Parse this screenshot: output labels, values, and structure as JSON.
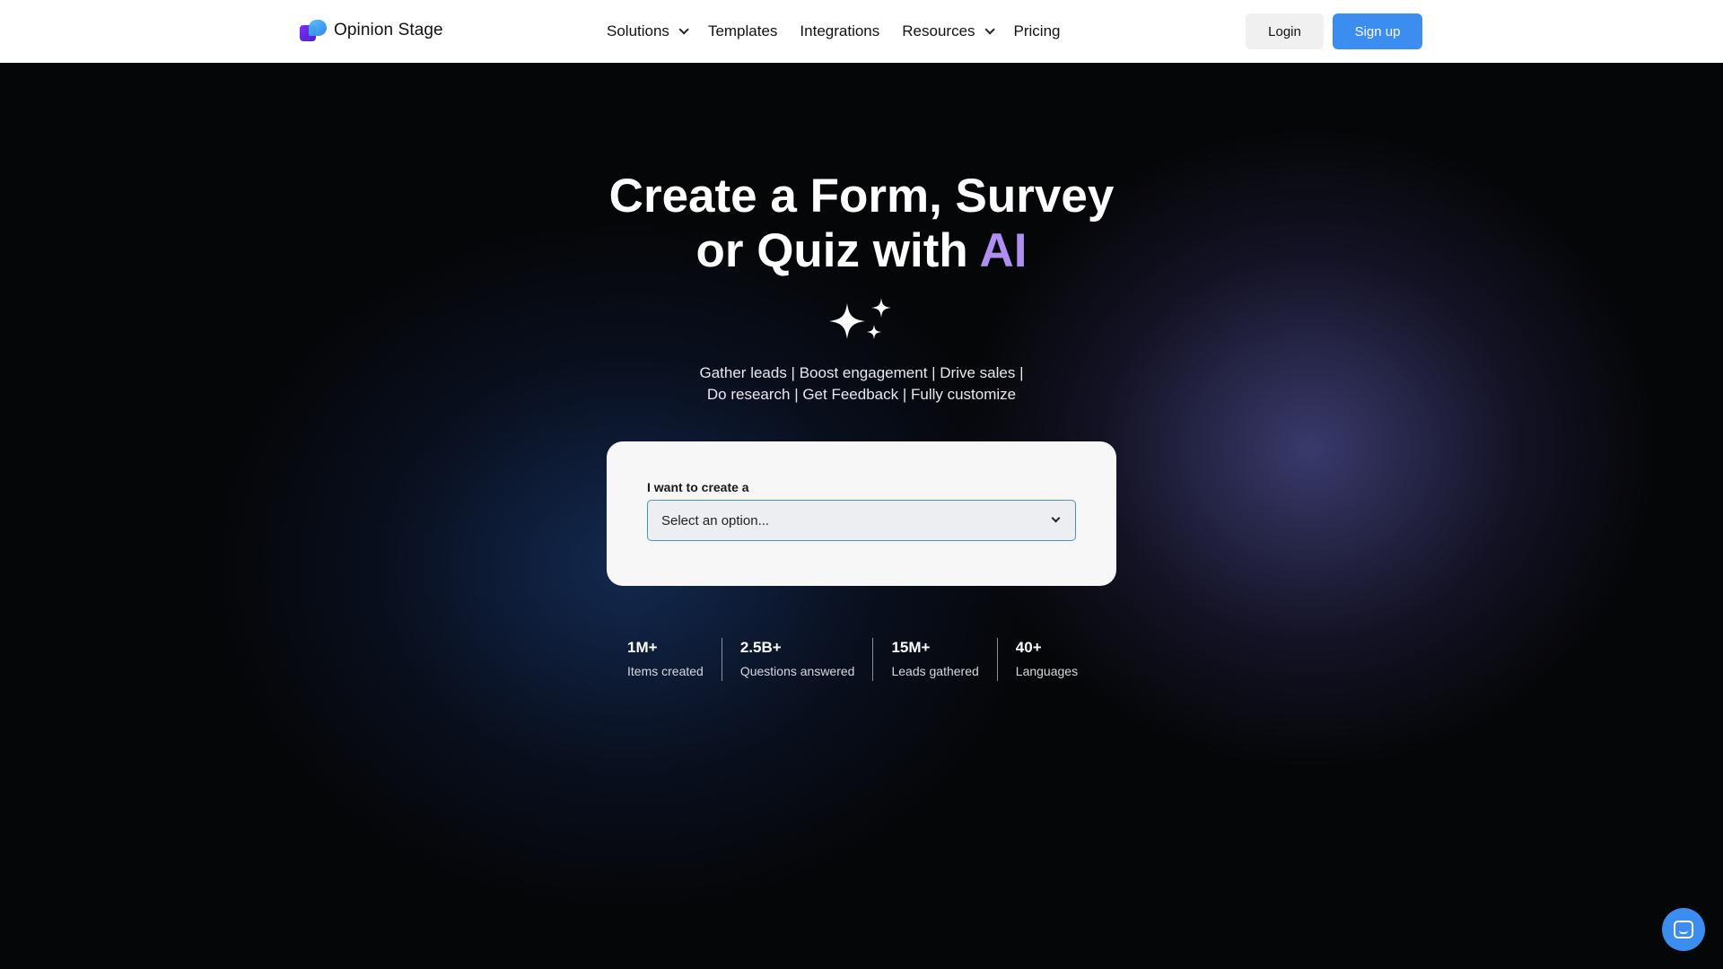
{
  "header": {
    "brand": "Opinion Stage",
    "nav": [
      {
        "label": "Solutions",
        "has_dropdown": true
      },
      {
        "label": "Templates",
        "has_dropdown": false
      },
      {
        "label": "Integrations",
        "has_dropdown": false
      },
      {
        "label": "Resources",
        "has_dropdown": true
      },
      {
        "label": "Pricing",
        "has_dropdown": false
      }
    ],
    "login_label": "Login",
    "signup_label": "Sign up"
  },
  "hero": {
    "headline_line1": "Create a Form, Survey",
    "headline_line2_prefix": "or Quiz with ",
    "headline_highlight": "AI",
    "subtitle_line1": "Gather leads | Boost engagement | Drive sales |",
    "subtitle_line2": "Do research | Get Feedback | Fully customize",
    "form": {
      "label": "I want to create a",
      "select_value": "Select an option..."
    },
    "stats": [
      {
        "value": "1M+",
        "label": "Items created"
      },
      {
        "value": "2.5B+",
        "label": "Questions answered"
      },
      {
        "value": "15M+",
        "label": "Leads gathered"
      },
      {
        "value": "40+",
        "label": "Languages"
      }
    ]
  },
  "colors": {
    "accent": "#3b8ef0",
    "ai_highlight": "#b08ef0",
    "hero_bg": "#050608"
  },
  "icons": [
    "logo-icon",
    "chevron-down-icon",
    "sparkle-icon",
    "chat-icon"
  ]
}
